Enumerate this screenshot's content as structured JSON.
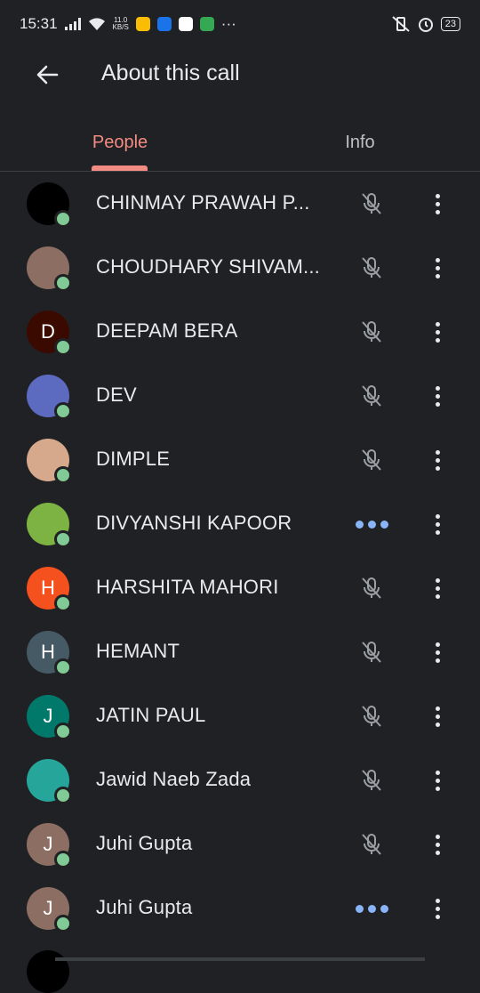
{
  "status_bar": {
    "time": "15:31",
    "net_speed_value": "11.0",
    "net_speed_unit": "KB/S",
    "battery": "23",
    "icons": [
      "signal-icon",
      "wifi-icon",
      "app-icon-photos",
      "app-icon-messenger",
      "app-icon-photos2",
      "app-icon-messages",
      "more-notifications-icon",
      "vibrate-off-icon",
      "alarm-icon",
      "battery-icon"
    ]
  },
  "header": {
    "title": "About this call"
  },
  "tabs": [
    {
      "label": "People",
      "active": true
    },
    {
      "label": "Info",
      "active": false
    }
  ],
  "participants": [
    {
      "name": "CHINMAY PRAWAH P...",
      "avatar_letter": "",
      "avatar_color": "#000000",
      "status": "muted"
    },
    {
      "name": "CHOUDHARY SHIVAM...",
      "avatar_letter": "",
      "avatar_color": "#8d6e63",
      "status": "muted"
    },
    {
      "name": "DEEPAM BERA",
      "avatar_letter": "D",
      "avatar_color": "#3a0a00",
      "status": "muted"
    },
    {
      "name": "DEV",
      "avatar_letter": "",
      "avatar_color": "#5c6bc0",
      "status": "muted"
    },
    {
      "name": "DIMPLE",
      "avatar_letter": "",
      "avatar_color": "#d7a98c",
      "status": "muted"
    },
    {
      "name": "DIVYANSHI KAPOOR",
      "avatar_letter": "",
      "avatar_color": "#7cb342",
      "status": "speaking"
    },
    {
      "name": "HARSHITA MAHORI",
      "avatar_letter": "H",
      "avatar_color": "#f4511e",
      "status": "muted"
    },
    {
      "name": "HEMANT",
      "avatar_letter": "H",
      "avatar_color": "#455a64",
      "status": "muted"
    },
    {
      "name": "JATIN PAUL",
      "avatar_letter": "J",
      "avatar_color": "#00796b",
      "status": "muted"
    },
    {
      "name": "Jawid Naeb Zada",
      "avatar_letter": "",
      "avatar_color": "#26a69a",
      "status": "muted"
    },
    {
      "name": "Juhi Gupta",
      "avatar_letter": "J",
      "avatar_color": "#8d6e63",
      "status": "muted"
    },
    {
      "name": "Juhi Gupta",
      "avatar_letter": "J",
      "avatar_color": "#8d6e63",
      "status": "speaking"
    }
  ],
  "colors": {
    "background": "#202124",
    "accent": "#f28b82",
    "speaking_dots": "#8ab4f8",
    "presence": "#81c995"
  }
}
